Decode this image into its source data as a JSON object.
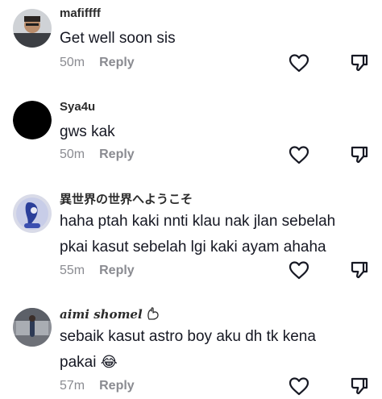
{
  "comments": [
    {
      "username": "mafiffff",
      "lines": [
        "Get well soon sis"
      ],
      "time": "50m",
      "reply": "Reply"
    },
    {
      "username": "Sya4u",
      "lines": [
        "gws kak"
      ],
      "time": "50m",
      "reply": "Reply"
    },
    {
      "username": "異世界の世界へようこそ",
      "lines": [
        "haha ptah kaki nnti klau nak jlan sebelah",
        "pkai kasut sebelah lgi kaki ayam ahaha"
      ],
      "time": "55m",
      "reply": "Reply"
    },
    {
      "username": "aimi shomel",
      "username_icon": "heart-hand-icon",
      "lines": [
        "sebaik kasut astro boy aku dh tk kena",
        "pakai"
      ],
      "emoji": "😂",
      "time": "57m",
      "reply": "Reply"
    }
  ],
  "icons": {
    "like": "heart-outline-icon",
    "dislike": "thumbs-down-outline-icon"
  }
}
